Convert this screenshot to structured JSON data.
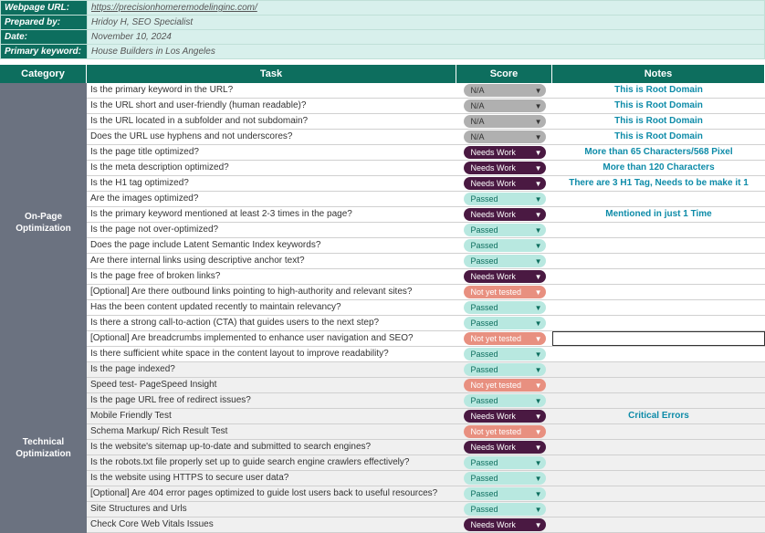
{
  "meta": {
    "url_label": "Webpage URL:",
    "url_value": "https://precisionhomeremodelinginc.com/",
    "prep_label": "Prepared by:",
    "prep_value": "Hridoy H, SEO Specialist",
    "date_label": "Date:",
    "date_value": "November 10, 2024",
    "kw_label": "Primary keyword:",
    "kw_value": "House Builders in Los Angeles"
  },
  "headers": {
    "category": "Category",
    "task": "Task",
    "score": "Score",
    "notes": "Notes"
  },
  "sections": [
    {
      "category": "On-Page\nOptimization",
      "rows": [
        {
          "task": "Is the primary keyword in the URL?",
          "score": "N/A",
          "type": "na",
          "note": "This is Root Domain"
        },
        {
          "task": "Is the URL short and user-friendly (human readable)?",
          "score": "N/A",
          "type": "na",
          "note": "This is Root Domain"
        },
        {
          "task": "Is the URL located in a subfolder and not subdomain?",
          "score": "N/A",
          "type": "na",
          "note": "This is Root Domain"
        },
        {
          "task": "Does the URL use hyphens and not underscores?",
          "score": "N/A",
          "type": "na",
          "note": "This is Root Domain"
        },
        {
          "task": "Is the page title optimized?",
          "score": "Needs Work",
          "type": "needs",
          "note": "More than 65 Characters/568 Pixel"
        },
        {
          "task": "Is the meta description optimized?",
          "score": "Needs Work",
          "type": "needs",
          "note": "More than 120 Characters"
        },
        {
          "task": "Is the H1 tag optimized?",
          "score": "Needs Work",
          "type": "needs",
          "note": "There are 3 H1 Tag, Needs to be make it 1"
        },
        {
          "task": "Are the images optimized?",
          "score": "Passed",
          "type": "passed",
          "note": ""
        },
        {
          "task": "Is the primary keyword mentioned at least 2-3 times in the page?",
          "score": "Needs Work",
          "type": "needs",
          "note": "Mentioned in just 1 Time"
        },
        {
          "task": "Is the page not over-optimized?",
          "score": "Passed",
          "type": "passed",
          "note": ""
        },
        {
          "task": "Does the page include Latent Semantic Index keywords?",
          "score": "Passed",
          "type": "passed",
          "note": ""
        },
        {
          "task": "Are there internal links using descriptive anchor text?",
          "score": "Passed",
          "type": "passed",
          "note": ""
        },
        {
          "task": "Is the page free of broken links?",
          "score": "Needs Work",
          "type": "needs",
          "note": ""
        },
        {
          "task": "[Optional] Are there outbound links pointing to high-authority and relevant sites?",
          "score": "Not yet tested",
          "type": "notyet",
          "note": ""
        },
        {
          "task": "Has the been content updated recently to maintain relevancy?",
          "score": "Passed",
          "type": "passed",
          "note": ""
        },
        {
          "task": "Is there a strong call-to-action (CTA) that guides users to the next step?",
          "score": "Passed",
          "type": "passed",
          "note": ""
        },
        {
          "task": "[Optional] Are breadcrumbs implemented to enhance user navigation and SEO?",
          "score": "Not yet tested",
          "type": "notyet",
          "note": "",
          "boxed": true
        },
        {
          "task": "Is there sufficient white space in the content layout to improve readability?",
          "score": "Passed",
          "type": "passed",
          "note": ""
        }
      ]
    },
    {
      "category": "Technical\nOptimization",
      "rows": [
        {
          "task": "Is the page indexed?",
          "score": "Passed",
          "type": "passed",
          "note": "",
          "alt": true
        },
        {
          "task": "Speed test- PageSpeed Insight",
          "score": "Not yet tested",
          "type": "notyet",
          "note": "",
          "alt": true
        },
        {
          "task": "Is the page URL free of redirect issues?",
          "score": "Passed",
          "type": "passed",
          "note": "",
          "alt": true
        },
        {
          "task": "Mobile Friendly Test",
          "score": "Needs Work",
          "type": "needs",
          "note": "Critical Errors",
          "alt": true
        },
        {
          "task": "Schema Markup/ Rich Result Test",
          "score": "Not yet tested",
          "type": "notyet",
          "note": "",
          "alt": true
        },
        {
          "task": "Is the website's sitemap up-to-date and submitted to search engines?",
          "score": "Needs Work",
          "type": "needs",
          "note": "",
          "alt": true
        },
        {
          "task": "Is the robots.txt file properly set up to guide search engine crawlers effectively?",
          "score": "Passed",
          "type": "passed",
          "note": "",
          "alt": true
        },
        {
          "task": "Is the website using HTTPS to secure user data?",
          "score": "Passed",
          "type": "passed",
          "note": "",
          "alt": true
        },
        {
          "task": "[Optional] Are 404 error pages optimized to guide lost users back to useful resources?",
          "score": "Passed",
          "type": "passed",
          "note": "",
          "alt": true
        },
        {
          "task": "Site Structures and Urls",
          "score": "Passed",
          "type": "passed",
          "note": "",
          "alt": true
        },
        {
          "task": "Check Core Web Vitals Issues",
          "score": "Needs Work",
          "type": "needs",
          "note": "",
          "alt": true
        }
      ]
    }
  ]
}
